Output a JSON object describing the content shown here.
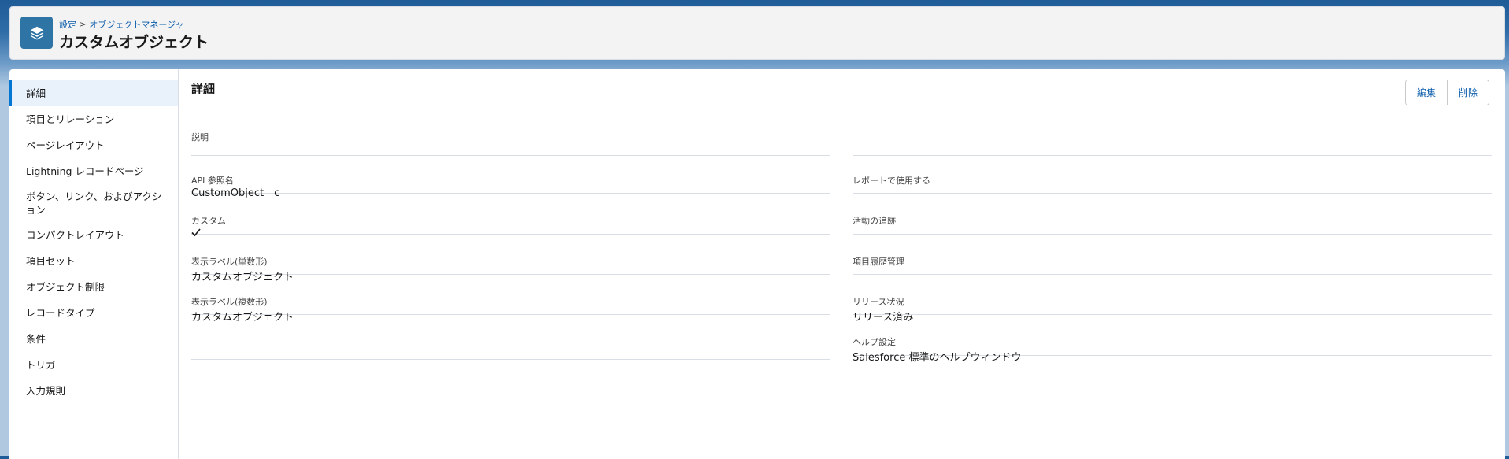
{
  "header": {
    "breadcrumb": [
      "設定",
      "オブジェクトマネージャ"
    ],
    "breadcrumb_sep": ">",
    "title": "カスタムオブジェクト",
    "icon": "layers-icon"
  },
  "sidebar": {
    "items": [
      {
        "label": "詳細",
        "active": true
      },
      {
        "label": "項目とリレーション"
      },
      {
        "label": "ページレイアウト"
      },
      {
        "label": "Lightning レコードページ"
      },
      {
        "label": "ボタン、リンク、およびアクション"
      },
      {
        "label": "コンパクトレイアウト"
      },
      {
        "label": "項目セット"
      },
      {
        "label": "オブジェクト制限"
      },
      {
        "label": "レコードタイプ"
      },
      {
        "label": "条件"
      },
      {
        "label": "トリガ"
      },
      {
        "label": "入力規則"
      }
    ]
  },
  "detail": {
    "title": "詳細",
    "buttons": {
      "edit": "編集",
      "delete": "削除"
    },
    "fields": {
      "description": {
        "label": "説明",
        "value": ""
      },
      "api_name": {
        "label": "API 参照名",
        "value": "CustomObject__c"
      },
      "custom": {
        "label": "カスタム",
        "checked": true
      },
      "label_singular": {
        "label": "表示ラベル(単数形)",
        "value": "カスタムオブジェクト"
      },
      "label_plural": {
        "label": "表示ラベル(複数形)",
        "value": "カスタムオブジェクト"
      },
      "use_in_reports": {
        "label": "レポートで使用する",
        "value": ""
      },
      "track_activities": {
        "label": "活動の追跡",
        "value": ""
      },
      "field_history": {
        "label": "項目履歴管理",
        "value": ""
      },
      "deployment_status": {
        "label": "リリース状況",
        "value": "リリース済み"
      },
      "help_settings": {
        "label": "ヘルプ設定",
        "value": "Salesforce 標準のヘルプウィンドウ"
      }
    }
  },
  "colors": {
    "brand": "#0176d3",
    "link": "#0b5cab",
    "icon_bg": "#2e75a6"
  }
}
